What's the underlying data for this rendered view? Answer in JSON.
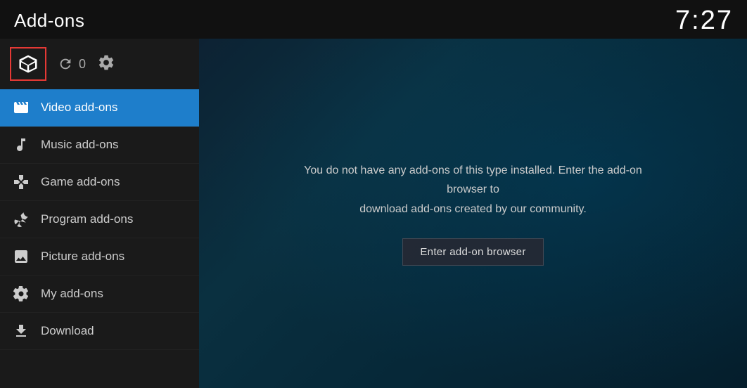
{
  "header": {
    "title": "Add-ons",
    "time": "7:27"
  },
  "icon_bar": {
    "refresh_count": "0"
  },
  "nav": {
    "items": [
      {
        "id": "video-addons",
        "label": "Video add-ons",
        "active": true,
        "icon": "film"
      },
      {
        "id": "music-addons",
        "label": "Music add-ons",
        "active": false,
        "icon": "music"
      },
      {
        "id": "game-addons",
        "label": "Game add-ons",
        "active": false,
        "icon": "gamepad"
      },
      {
        "id": "program-addons",
        "label": "Program add-ons",
        "active": false,
        "icon": "wrench"
      },
      {
        "id": "picture-addons",
        "label": "Picture add-ons",
        "active": false,
        "icon": "image"
      },
      {
        "id": "my-addons",
        "label": "My add-ons",
        "active": false,
        "icon": "gear-multi"
      },
      {
        "id": "download",
        "label": "Download",
        "active": false,
        "icon": "download"
      }
    ]
  },
  "content": {
    "message_line1": "You do not have any add-ons of this type installed. Enter the add-on browser to",
    "message_line2": "download add-ons created by our community.",
    "button_label": "Enter add-on browser"
  }
}
